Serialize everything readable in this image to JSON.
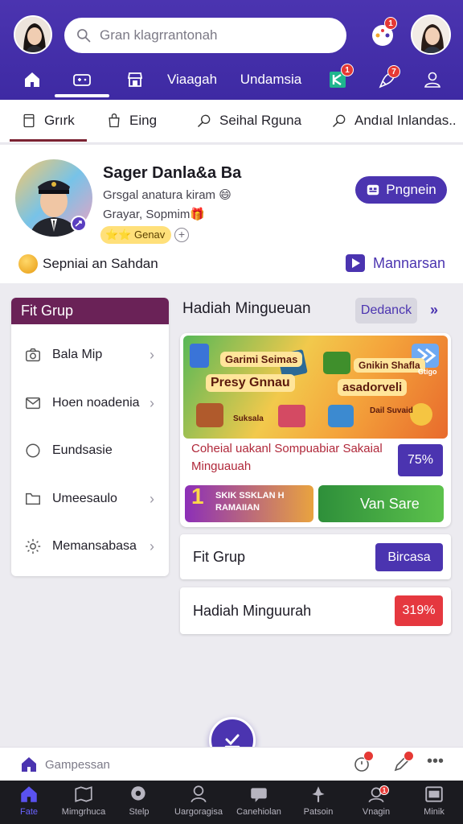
{
  "search": {
    "placeholder": "Gran klagrrantonah"
  },
  "header": {
    "nav": [
      {
        "icon": "home-icon",
        "label": ""
      },
      {
        "icon": "gamepad-icon",
        "label": ""
      },
      {
        "icon": "shop-icon",
        "label": ""
      },
      {
        "icon": "",
        "label": "Viaagah"
      },
      {
        "icon": "",
        "label": "Undamsia"
      },
      {
        "icon": "grid-app-icon",
        "label": "",
        "badge": "1"
      },
      {
        "icon": "rocket-icon",
        "label": "",
        "badge": "7"
      },
      {
        "icon": "user-icon",
        "label": ""
      }
    ],
    "notif_badge": "1"
  },
  "tabs": [
    {
      "label": "Grırk",
      "icon": "bookmark-icon"
    },
    {
      "label": "Eing",
      "icon": "bag-icon"
    },
    {
      "label": "Seihal Rguna",
      "icon": "search-icon"
    },
    {
      "label": "Andıal Inlandas..",
      "icon": "search-icon"
    }
  ],
  "profile": {
    "name": "Sager Danla&a Ba",
    "line1": "Grsgal anatura kiram 😄",
    "line2": "Grayar, Sopmim🎁",
    "badge": "⭐⭐ Genav",
    "action_button": "Pngnein",
    "coin_text": "Sepniai an Sahdan",
    "link_text": "Mannarsan"
  },
  "left_menu": {
    "title": "Fit Grup",
    "items": [
      {
        "label": "Bala Mip",
        "icon": "camera-icon",
        "chevron": true
      },
      {
        "label": "Hoen noadenia",
        "icon": "mail-icon",
        "chevron": true
      },
      {
        "label": "Eundsasie",
        "icon": "circle-icon",
        "chevron": false
      },
      {
        "label": "Umeesaulo",
        "icon": "folder-icon",
        "chevron": true
      },
      {
        "label": "Memansabasa",
        "icon": "gear-icon",
        "chevron": true
      }
    ]
  },
  "right": {
    "title": "Hadiah Mingueuan",
    "button": "Dedanck",
    "more": "»",
    "promo": {
      "banner_texts": [
        "Garimi Seimas",
        "Presy Gnnau",
        "Gnikin Shafla",
        "asadorveli",
        "Suksala",
        "Dail Suvaid",
        "Gtigo"
      ],
      "description": "Coheial uakanl Sompuabiar Sakaial Minguauah",
      "percent": "75%",
      "tile1_big": "1",
      "tile1_text": "SKIK SSKLAN H RAMAIIAN",
      "tile2_text": "Van Sare"
    },
    "cards": [
      {
        "label": "Fit Grup",
        "button": "Bircasa",
        "color": "#4b34b0"
      },
      {
        "label": "Hadiah Minguurah",
        "button": "319%",
        "color": "#e5383f"
      }
    ]
  },
  "sub_bar": {
    "home_label": "Gampessan"
  },
  "bottom_nav": [
    {
      "label": "Fate",
      "icon": "home-icon",
      "active": true
    },
    {
      "label": "Mimgrhuca",
      "icon": "map-icon"
    },
    {
      "label": "Stelp",
      "icon": "search-icon"
    },
    {
      "label": "Uargoragisa",
      "icon": "person-icon"
    },
    {
      "label": "Canehiolan",
      "icon": "chat-icon"
    },
    {
      "label": "Patsoin",
      "icon": "pin-icon"
    },
    {
      "label": "Vnagin",
      "icon": "user-icon",
      "badge": "1"
    },
    {
      "label": "Minik",
      "icon": "window-icon"
    }
  ]
}
